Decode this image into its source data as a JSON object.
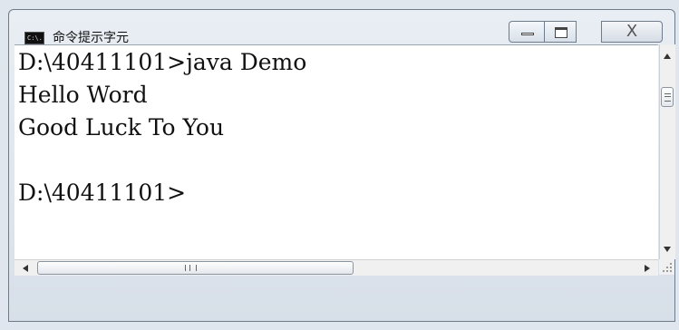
{
  "window": {
    "title": "命令提示字元",
    "app_icon_label": "C:\\."
  },
  "controls": {
    "minimize_icon": "minimize-icon",
    "maximize_icon": "maximize-icon",
    "close_glyph": "X"
  },
  "console": {
    "lines": [
      "D:\\40411101>java Demo",
      "Hello Word",
      "Good Luck To You",
      "",
      "D:\\40411101>"
    ]
  },
  "colors": {
    "console_bg": "#ffffff",
    "text": "#111111",
    "chrome": "#dfe6ee"
  }
}
